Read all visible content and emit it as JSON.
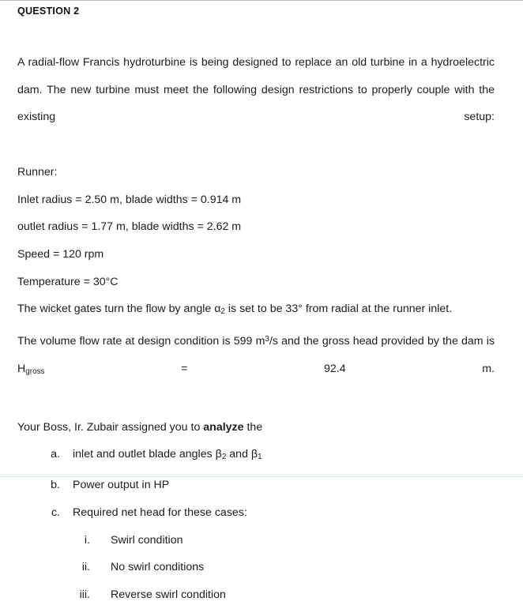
{
  "document": {
    "heading": "QUESTION 2",
    "intro_paragraph": "A radial-flow Francis hydroturbine is being designed to replace an old turbine in a hydroelectric dam. The new turbine must meet the following design restrictions to properly couple with the existing setup:",
    "runner_label": "Runner:",
    "runner_specs": [
      "Inlet radius = 2.50 m, blade widths = 0.914 m",
      "outlet radius = 1.77 m, blade widths = 2.62 m",
      "Speed = 120 rpm",
      "Temperature = 30°C"
    ],
    "wicket_gate_sentence": {
      "before_symbol": "The wicket gates turn the flow by angle ",
      "symbol": "α",
      "symbol_subscript": "2",
      "after_symbol": " is set to be 33° from radial at the runner inlet."
    },
    "flow_rate_sentence": {
      "part_1": "The volume flow rate at design condition is 599 m",
      "superscript": "3",
      "part_2": "/s and the gross head provided by the dam is H",
      "subscript": "gross",
      "part_3": " = 92.4 m."
    },
    "task_sentence": {
      "before_bold": "Your Boss, Ir. Zubair assigned you to ",
      "bold_word": "analyze",
      "after_bold": " the"
    },
    "tasks": [
      {
        "marker": "a.",
        "text_before": "inlet and outlet blade angles ",
        "symbol_1": "β",
        "subscript_1": "2",
        "text_middle": " and ",
        "symbol_2": "β",
        "subscript_2": "1",
        "text_after": ""
      },
      {
        "marker": "b.",
        "text_before": "Power output in HP",
        "symbol_1": "",
        "subscript_1": "",
        "text_middle": "",
        "symbol_2": "",
        "subscript_2": "",
        "text_after": ""
      },
      {
        "marker": "c.",
        "text_before": "Required net head for these cases:",
        "symbol_1": "",
        "subscript_1": "",
        "text_middle": "",
        "symbol_2": "",
        "subscript_2": "",
        "text_after": ""
      }
    ],
    "subtasks": [
      {
        "marker": "i.",
        "text": "Swirl condition"
      },
      {
        "marker": "ii.",
        "text": "No swirl conditions"
      },
      {
        "marker": "iii.",
        "text": "Reverse swirl condition"
      }
    ]
  },
  "colors": {
    "page_background": "#ffffff",
    "body_text": "#1c1c1c",
    "heading_text": "#111111",
    "top_rule": "#b9b9b9",
    "bottom_rule": "#d8e6e6"
  }
}
